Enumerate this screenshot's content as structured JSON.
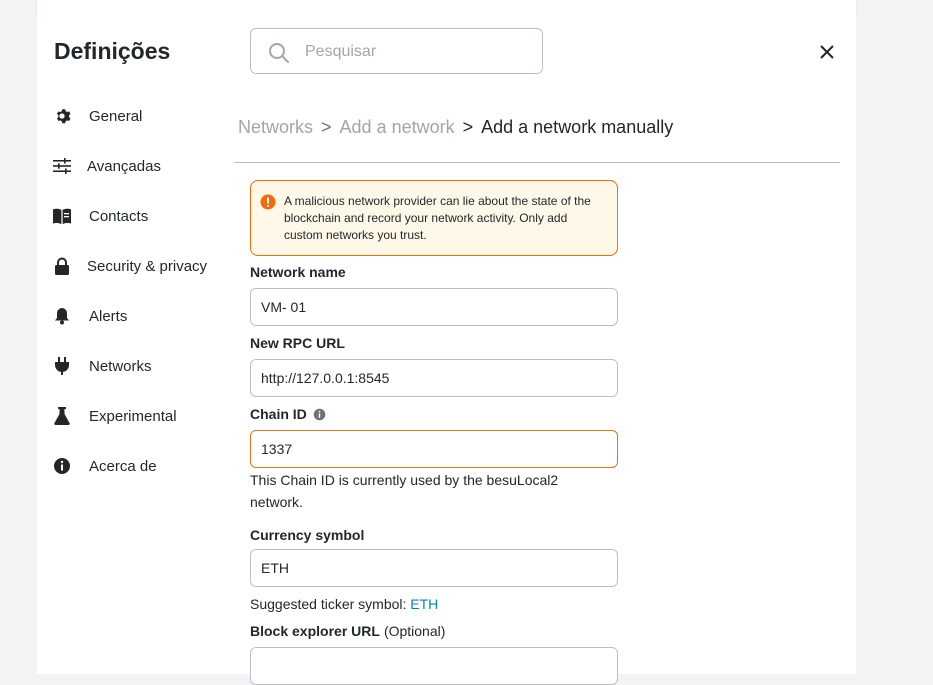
{
  "page": {
    "title": "Definições"
  },
  "search": {
    "placeholder": "Pesquisar"
  },
  "sidebar": {
    "items": [
      {
        "label": "General",
        "icon": "gear-icon"
      },
      {
        "label": "Avançadas",
        "icon": "sliders-icon"
      },
      {
        "label": "Contacts",
        "icon": "book-icon"
      },
      {
        "label": "Security & privacy",
        "icon": "lock-icon"
      },
      {
        "label": "Alerts",
        "icon": "bell-icon"
      },
      {
        "label": "Networks",
        "icon": "plug-icon"
      },
      {
        "label": "Experimental",
        "icon": "flask-icon"
      },
      {
        "label": "Acerca de",
        "icon": "info-icon"
      }
    ]
  },
  "breadcrumb": {
    "items": [
      "Networks",
      "Add a network"
    ],
    "separator": ">",
    "current": "Add a network manually"
  },
  "warning": {
    "text": "A malicious network provider can lie about the state of the blockchain and record your network activity. Only add custom networks you trust.",
    "color": "#f66a0a"
  },
  "form": {
    "network_name": {
      "label": "Network name",
      "value": "VM- 01"
    },
    "rpc_url": {
      "label": "New RPC URL",
      "value": "http://127.0.0.1:8545"
    },
    "chain_id": {
      "label": "Chain ID",
      "value": "1337",
      "message": "This Chain ID is currently used by the besuLocal2 network."
    },
    "currency_symbol": {
      "label": "Currency symbol",
      "value": "ETH",
      "suggestion_prefix": "Suggested ticker symbol:",
      "suggestion_value": "ETH"
    },
    "block_explorer": {
      "label": "Block explorer URL",
      "optional": "(Optional)",
      "value": ""
    }
  },
  "colors": {
    "accent": "#037dd6",
    "warning_bg": "#fef8e8",
    "error_border": "#e2761b"
  }
}
